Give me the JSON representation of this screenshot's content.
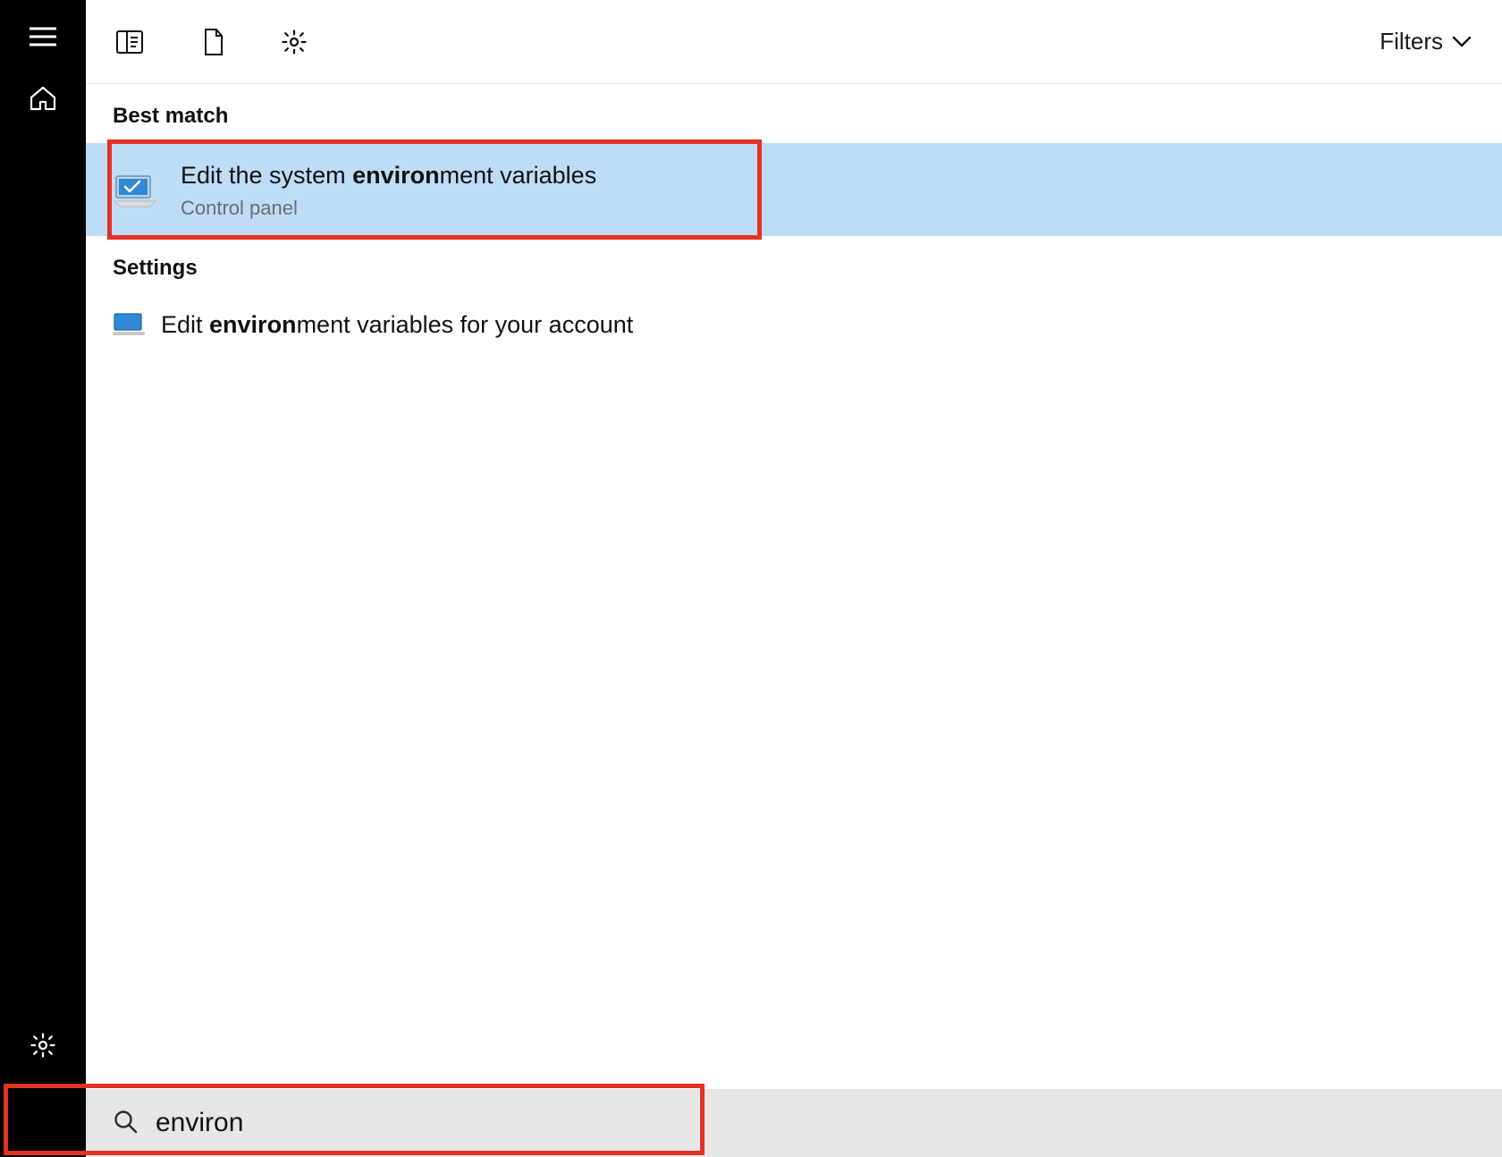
{
  "filterbar": {
    "filters_label": "Filters"
  },
  "sections": {
    "best_match_header": "Best match",
    "settings_header": "Settings"
  },
  "best_match": {
    "title_pre": "Edit the system ",
    "title_bold": "environ",
    "title_post": "ment variables",
    "subtitle": "Control panel"
  },
  "settings_item": {
    "title_pre": "Edit ",
    "title_bold": "environ",
    "title_post": "ment variables for your account"
  },
  "search": {
    "value": "environ",
    "placeholder": ""
  }
}
